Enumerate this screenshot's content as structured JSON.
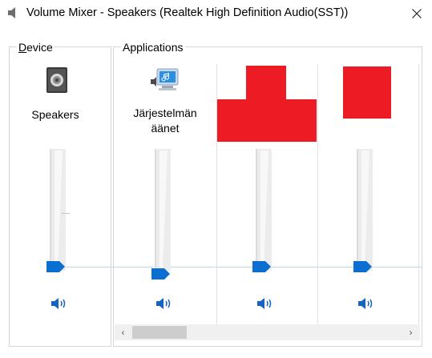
{
  "window": {
    "title": "Volume Mixer - Speakers (Realtek High Definition Audio(SST))",
    "close_glyph": "✕"
  },
  "device": {
    "group_label_hotkey": "D",
    "group_label_rest": "evice",
    "name": "Speakers",
    "icon": "speaker-device-icon",
    "volume": 0,
    "mute_icon": "speaker-volume-icon"
  },
  "applications": {
    "group_label": "Applications",
    "channels": [
      {
        "name_line1": "Järjestelmän",
        "name_line2": "äänet",
        "icon": "system-sounds-icon",
        "volume": 0,
        "mute_icon": "speaker-volume-icon"
      },
      {
        "name_line1": "",
        "name_line2": "",
        "icon": "redacted-app-icon",
        "volume": 0,
        "mute_icon": "speaker-volume-icon"
      },
      {
        "name_line1": "",
        "name_line2": "",
        "icon": "redacted-app-icon",
        "volume": 0,
        "mute_icon": "speaker-volume-icon"
      }
    ]
  },
  "scrollbar": {
    "left_arrow": "‹",
    "right_arrow": "›",
    "position": 0
  },
  "colors": {
    "slider_thumb": "#0b6fd1",
    "mute_icon": "#1565c0",
    "redaction": "#ed1c24"
  }
}
